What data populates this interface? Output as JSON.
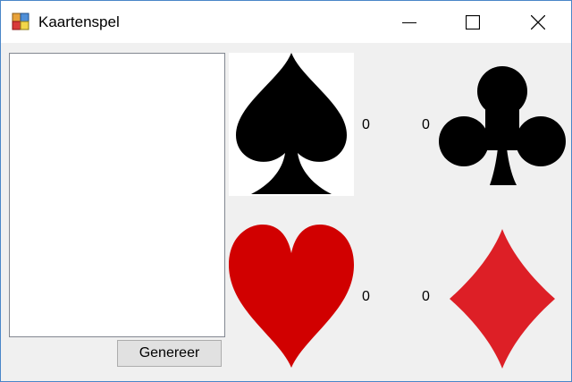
{
  "window": {
    "title": "Kaartenspel"
  },
  "controls": {
    "generate_label": "Genereer"
  },
  "counts": {
    "spades": "0",
    "clubs": "0",
    "hearts": "0",
    "diamonds": "0"
  },
  "colors": {
    "spades": "#000000",
    "clubs": "#000000",
    "hearts": "#d10000",
    "diamonds": "#dd1f26",
    "window_border": "#4a86c8"
  },
  "icons": {
    "spades": "spade-icon",
    "clubs": "club-icon",
    "hearts": "heart-icon",
    "diamonds": "diamond-icon"
  }
}
